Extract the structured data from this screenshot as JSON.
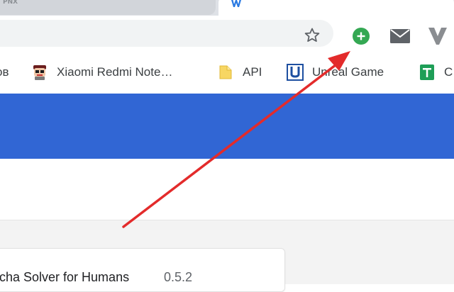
{
  "tabs": [
    {
      "label": "PNX",
      "active": false
    },
    {
      "label": "",
      "active": true,
      "favicon": "w-favicon-icon"
    }
  ],
  "toolbar": {
    "icons": [
      "star-icon",
      "extension-add-icon",
      "mail-icon",
      "vivaldi-icon"
    ],
    "extension_color": "#34a853"
  },
  "bookmarks": {
    "items": [
      {
        "label": "ов",
        "icon": ""
      },
      {
        "label": "Xiaomi Redmi Note…",
        "icon": "robot-avatar-icon"
      },
      {
        "label": "API",
        "icon": "folder-icon"
      },
      {
        "label": "Unreal Game",
        "icon": "u-logo-icon"
      },
      {
        "label": "C",
        "icon": "sheets-icon"
      }
    ]
  },
  "banner": {
    "color": "#3166d4"
  },
  "extension_card": {
    "title": "cha Solver for Humans",
    "version": "0.5.2"
  },
  "annotation": {
    "type": "arrow",
    "color": "#e32b2b",
    "points_to": "extension-add-icon"
  }
}
